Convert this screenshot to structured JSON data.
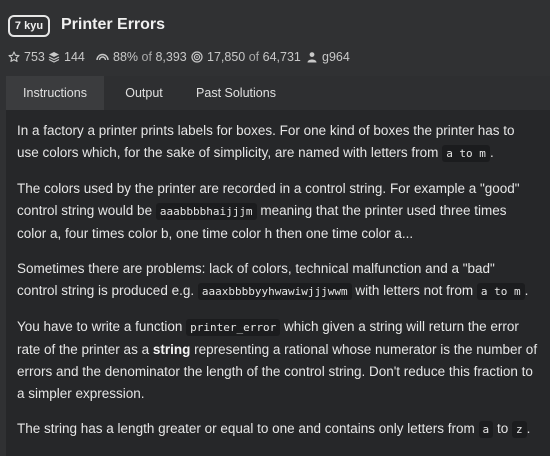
{
  "kata": {
    "rank": "7 kyu",
    "title": "Printer Errors"
  },
  "stats": {
    "stars": "753",
    "collections": "144",
    "satisfaction": "88%",
    "satisfaction_of": "of",
    "satisfaction_votes": "8,393",
    "completed": "17,850",
    "completed_of": "of",
    "attempts": "64,731",
    "author": "g964"
  },
  "tabs": [
    {
      "label": "Instructions"
    },
    {
      "label": "Output"
    },
    {
      "label": "Past Solutions"
    }
  ],
  "description": {
    "p1": {
      "text": "In a factory a printer prints labels for boxes. For one kind of boxes the printer has to use colors which, for the sake of simplicity, are named with letters from",
      "code": "a to m",
      "end": "."
    },
    "p2": {
      "text_a": "The colors used by the printer are recorded in a control string. For example a \"good\" control string would be",
      "code": "aaabbbbhaijjjm",
      "text_b": "meaning that the printer used three times color a, four times color b, one time color h then one time color a..."
    },
    "p3": {
      "text_a": "Sometimes there are problems: lack of colors, technical malfunction and a \"bad\" control string is produced e.g.",
      "code_a": "aaaxbbbbyyhwawiwjjjwwm",
      "text_b": "with letters not from",
      "code_b": "a to m",
      "end": "."
    },
    "p4": {
      "text_a": "You have to write a function",
      "code": "printer_error",
      "text_b": "which given a string will return the error rate of the printer as a",
      "strong": "string",
      "text_c": "representing a rational whose numerator is the number of errors and the denominator the length of the control string. Don't reduce this fraction to a simpler expression."
    },
    "p5": {
      "text_a": "The string has a length greater or equal to one and contains only letters from",
      "code_a": "a",
      "text_b": "to",
      "code_b": "z",
      "end": "."
    }
  },
  "icons": {
    "stars": "star-icon",
    "collections": "stack-icon",
    "satisfaction": "rainbow-icon",
    "completed": "target-icon",
    "author": "user-icon"
  }
}
